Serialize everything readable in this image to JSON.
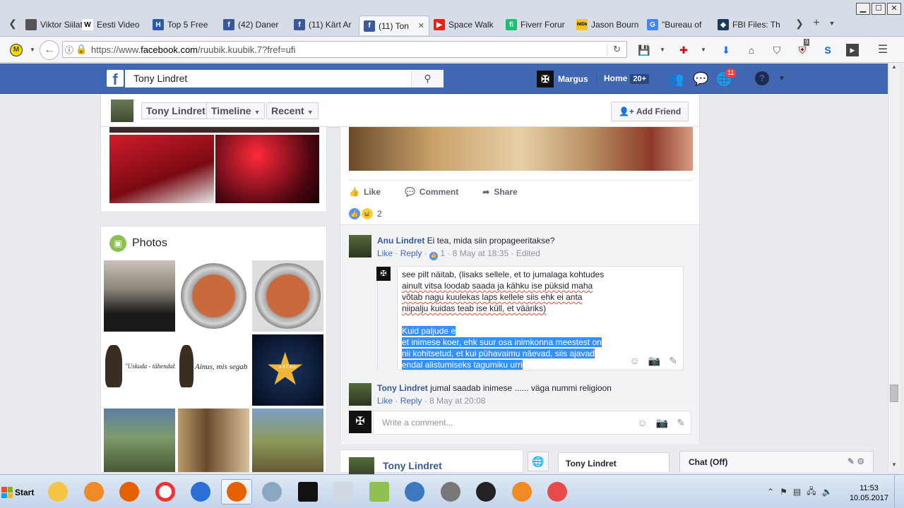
{
  "browser": {
    "tabs": [
      {
        "label": "Viktor Siilat",
        "icon": "generic-tab-icon",
        "color": "#555555",
        "glyph": ""
      },
      {
        "label": "Eesti Video",
        "icon": "wikipedia-icon",
        "color": "#ffffff",
        "glyph": "W"
      },
      {
        "label": "Top 5 Free",
        "icon": "h-site-icon",
        "color": "#2a5aa8",
        "glyph": "H"
      },
      {
        "label": "(42) Daner",
        "icon": "facebook-icon",
        "color": "#3b5998",
        "glyph": "f"
      },
      {
        "label": "(11) Kärt Ar",
        "icon": "facebook-icon",
        "color": "#3b5998",
        "glyph": "f"
      },
      {
        "label": "(11) Ton",
        "icon": "facebook-icon",
        "color": "#3b5998",
        "glyph": "f",
        "active": true
      },
      {
        "label": "Space Walk",
        "icon": "youtube-icon",
        "color": "#e62117",
        "glyph": "▶"
      },
      {
        "label": "Fiverr Forur",
        "icon": "fiverr-icon",
        "color": "#1dbf73",
        "glyph": "fi"
      },
      {
        "label": "Jason Bourn",
        "icon": "imdb-icon",
        "color": "#f5c518",
        "glyph": "IMDb"
      },
      {
        "label": "\"Bureau of",
        "icon": "google-icon",
        "color": "#4285f4",
        "glyph": "G"
      },
      {
        "label": "FBI Files: Th",
        "icon": "fbi-icon",
        "color": "#1b3a5a",
        "glyph": "◆"
      }
    ],
    "url_prefix": "https://www.",
    "url_domain": "facebook.com",
    "url_path": "/ruubik.kuubik.7?fref=ufi",
    "extension_badge": "9"
  },
  "facebook": {
    "search_value": "Tony Lindret",
    "user_name": "Margus",
    "home_label": "Home",
    "home_count": "20+",
    "notifications_count": "11"
  },
  "profile_bar": {
    "name": "Tony Lindret",
    "timeline": "Timeline",
    "recent": "Recent",
    "add_friend": "Add Friend"
  },
  "photos": {
    "title": "Photos",
    "captions": [
      "\"Uskuda - tähendab i",
      "Ainus, mis segab õpp",
      "ASTRA"
    ]
  },
  "post": {
    "actions": {
      "like": "Like",
      "comment": "Comment",
      "share": "Share"
    },
    "reaction_count": "2",
    "comments": [
      {
        "author": "Anu Lindret",
        "text": "Ei tea, mida siin propageeritakse?",
        "like": "Like",
        "reply": "Reply",
        "likes": "1",
        "time": "8 May at 18:35",
        "edited": "Edited"
      },
      {
        "author": "Tony Lindret",
        "text": "jumal saadab inimese ...... väga nummi religioon",
        "like": "Like",
        "reply": "Reply",
        "time": "8 May at 20:08"
      }
    ],
    "reply_draft": {
      "line1": "see pilt näitab, (lisaks sellele, et to jumalaga kohtudes",
      "line2": "ainult vitsa loodab saada ja kähku ise püksid maha",
      "line3": "võtab nagu kuulekas laps kellele siis ehk ei anta",
      "line4": "niipalju kuidas teab ise küll, et vääriks)",
      "sel1": "Kuid paljude e",
      "sel2": "et inimese koer, ehk suur osa inimkonna meestest on",
      "sel3": "nii kohitsetud, et kui pühavaimu näevad, siis ajavad",
      "sel4": "endal alistumiseks tagumiku urri"
    },
    "write_comment_placeholder": "Write a comment..."
  },
  "next_post": {
    "name": "Tony Lindret"
  },
  "chat": {
    "tab_name": "Tony Lindret",
    "status": "Chat (Off)"
  },
  "taskbar": {
    "start": "Start",
    "time": "11:53",
    "date": "10.05.2017"
  }
}
